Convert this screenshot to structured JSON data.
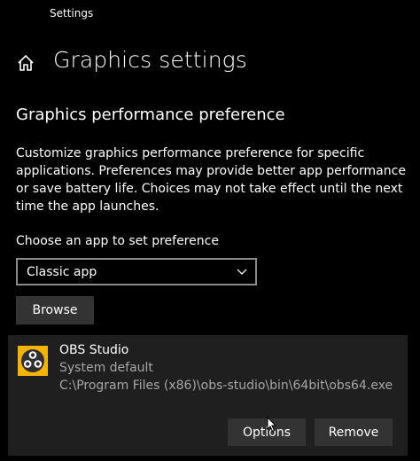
{
  "window": {
    "title": "Settings"
  },
  "header": {
    "title": "Graphics settings",
    "home_icon": "home-icon"
  },
  "section": {
    "heading": "Graphics performance preference",
    "description": "Customize graphics performance preference for specific applications. Preferences may provide better app performance or save battery life. Choices may not take effect until the next time the app launches."
  },
  "chooser": {
    "label": "Choose an app to set preference",
    "selected": "Classic app",
    "browse_label": "Browse"
  },
  "app": {
    "name": "OBS Studio",
    "preference": "System default",
    "path": "C:\\Program Files (x86)\\obs-studio\\bin\\64bit\\obs64.exe",
    "options_label": "Options",
    "remove_label": "Remove",
    "icon_color": "#f5b400"
  },
  "colors": {
    "background": "#000000",
    "panel": "#1f1f1f",
    "button": "#333333",
    "secondary_text": "#a6a6a6"
  }
}
